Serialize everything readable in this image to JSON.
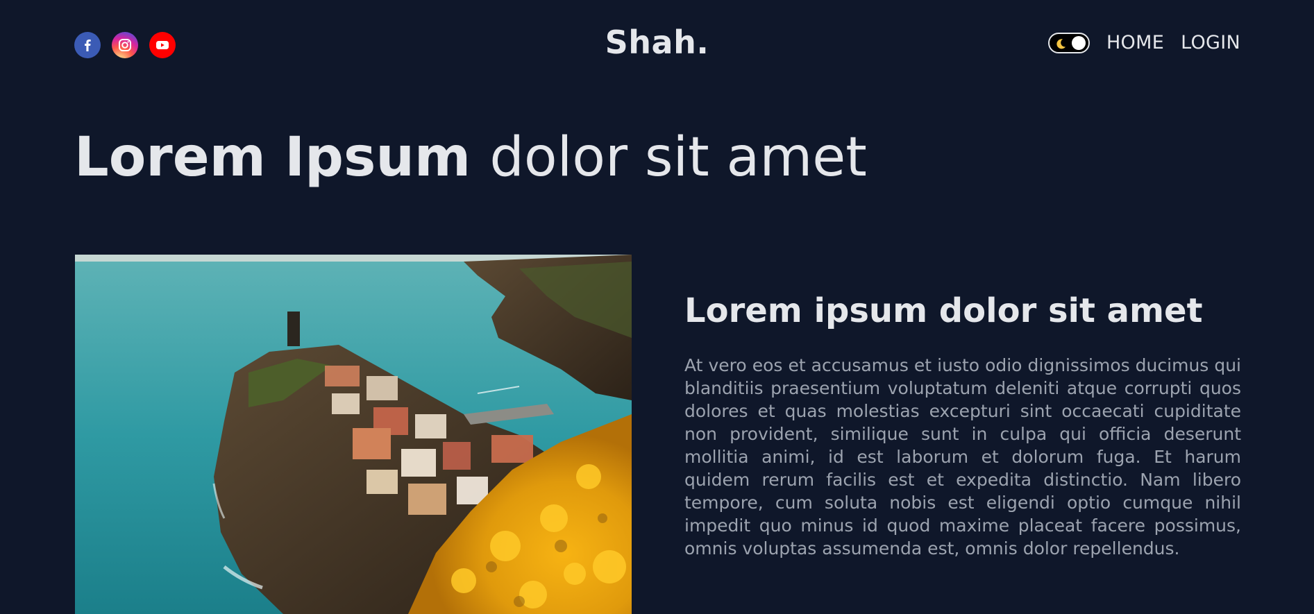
{
  "header": {
    "brand": "Shah.",
    "socials": [
      {
        "name": "facebook-icon",
        "color": "#3b5bb5"
      },
      {
        "name": "instagram-icon",
        "color": "#d6249f"
      },
      {
        "name": "youtube-icon",
        "color": "#ff0000"
      }
    ],
    "theme_toggle": {
      "icon": "moon-icon",
      "state": "dark"
    },
    "nav": {
      "home": "HOME",
      "login": "LOGIN"
    }
  },
  "hero": {
    "title_bold": "Lorem Ipsum",
    "title_light": "dolor sit amet"
  },
  "article": {
    "heading": "Lorem ipsum dolor sit amet",
    "body": "At vero eos et accusamus et iusto odio dignissimos ducimus qui blanditiis praesentium voluptatum deleniti atque corrupti quos dolores et quas molestias excepturi sint occaecati cupiditate non provident, similique sunt in culpa qui officia deserunt mollitia animi, id est laborum et dolorum fuga. Et harum quidem rerum facilis est et expedita distinctio. Nam libero tempore, cum soluta nobis est eligendi optio cumque nihil impedit quo minus id quod maxime placeat facere possimus, omnis voluptas assumenda est, omnis dolor repellendus.",
    "image": "coastal-village-photo"
  },
  "colors": {
    "background": "#0f172a",
    "text": "#e5e7eb",
    "muted": "#9ca3af"
  }
}
